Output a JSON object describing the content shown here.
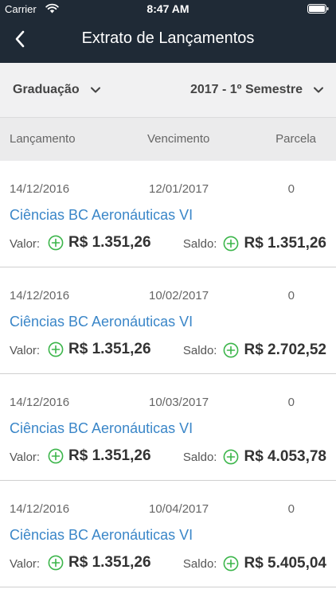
{
  "status_bar": {
    "carrier": "Carrier",
    "time": "8:47 AM"
  },
  "nav": {
    "title": "Extrato de Lançamentos"
  },
  "filters": {
    "level": "Graduação",
    "period": "2017 - 1º Semestre"
  },
  "columns": {
    "launch": "Lançamento",
    "due": "Vencimento",
    "installment": "Parcela"
  },
  "labels": {
    "value": "Valor:",
    "balance": "Saldo:"
  },
  "colors": {
    "header_bg": "#1f2a36",
    "link_blue": "#3a86c8",
    "plus_green": "#3bb54a"
  },
  "entries": [
    {
      "launch_date": "14/12/2016",
      "due_date": "12/01/2017",
      "installment": "0",
      "course": "Ciências BC Aeronáuticas VI",
      "value": "R$ 1.351,26",
      "balance": "R$ 1.351,26"
    },
    {
      "launch_date": "14/12/2016",
      "due_date": "10/02/2017",
      "installment": "0",
      "course": "Ciências BC Aeronáuticas VI",
      "value": "R$ 1.351,26",
      "balance": "R$ 2.702,52"
    },
    {
      "launch_date": "14/12/2016",
      "due_date": "10/03/2017",
      "installment": "0",
      "course": "Ciências BC Aeronáuticas VI",
      "value": "R$ 1.351,26",
      "balance": "R$ 4.053,78"
    },
    {
      "launch_date": "14/12/2016",
      "due_date": "10/04/2017",
      "installment": "0",
      "course": "Ciências BC Aeronáuticas VI",
      "value": "R$ 1.351,26",
      "balance": "R$ 5.405,04"
    }
  ]
}
